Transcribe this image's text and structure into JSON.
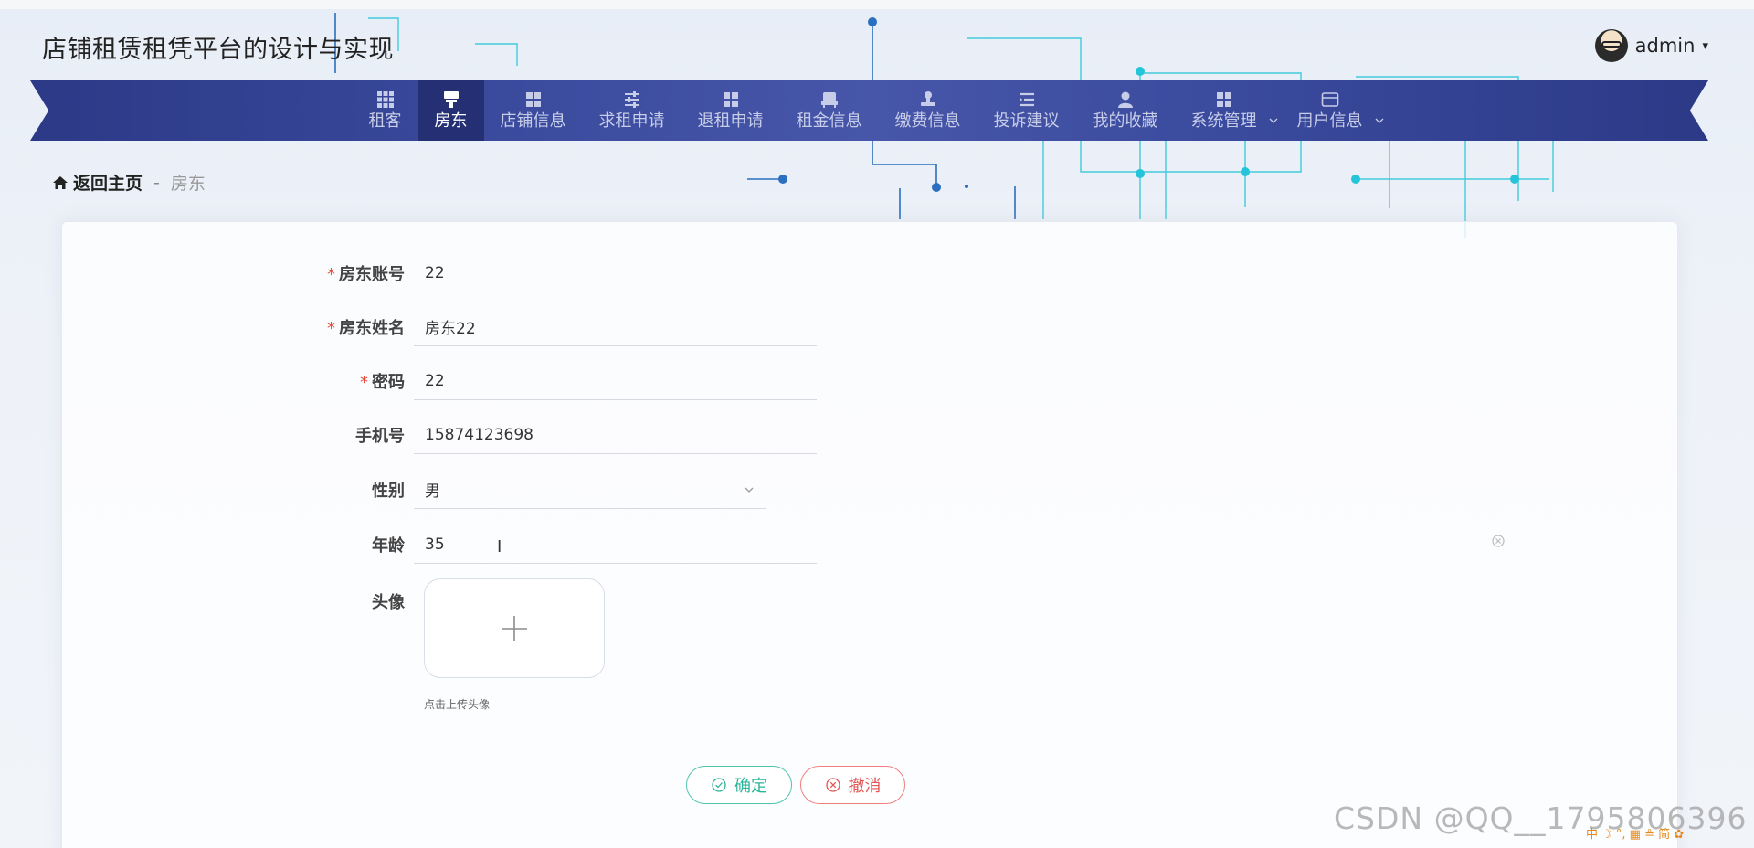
{
  "header": {
    "site_title": "店铺租赁租凭平台的设计与实现",
    "user_name": "admin",
    "user_caret": "▾"
  },
  "nav": {
    "items": [
      {
        "label": "租客"
      },
      {
        "label": "房东"
      },
      {
        "label": "店铺信息"
      },
      {
        "label": "求租申请"
      },
      {
        "label": "退租申请"
      },
      {
        "label": "租金信息"
      },
      {
        "label": "缴费信息"
      },
      {
        "label": "投诉建议"
      },
      {
        "label": "我的收藏"
      },
      {
        "label": "系统管理"
      },
      {
        "label": "用户信息"
      }
    ],
    "active_index": 1
  },
  "breadcrumb": {
    "home": "返回主页",
    "separator": "-",
    "current": "房东"
  },
  "form": {
    "required_mark": "*",
    "account": {
      "label": "房东账号",
      "value": "22"
    },
    "name": {
      "label": "房东姓名",
      "value": "房东22"
    },
    "password": {
      "label": "密码",
      "value": "22"
    },
    "phone": {
      "label": "手机号",
      "value": "15874123698"
    },
    "gender": {
      "label": "性别",
      "value": "男"
    },
    "age": {
      "label": "年龄",
      "value": "35"
    },
    "avatar": {
      "label": "头像",
      "hint": "点击上传头像"
    },
    "confirm_label": "确定",
    "cancel_label": "撤消"
  },
  "overlay": {
    "watermark": "CSDN @QQ__1795806396",
    "ime_bar": "中 ☽ °, ▦ ≗ 简 ✿"
  },
  "colors": {
    "nav_bg": "#3b4b9e",
    "nav_active": "#252f74",
    "confirm": "#2bb59a",
    "cancel": "#e05555",
    "required": "#e74c3c"
  }
}
